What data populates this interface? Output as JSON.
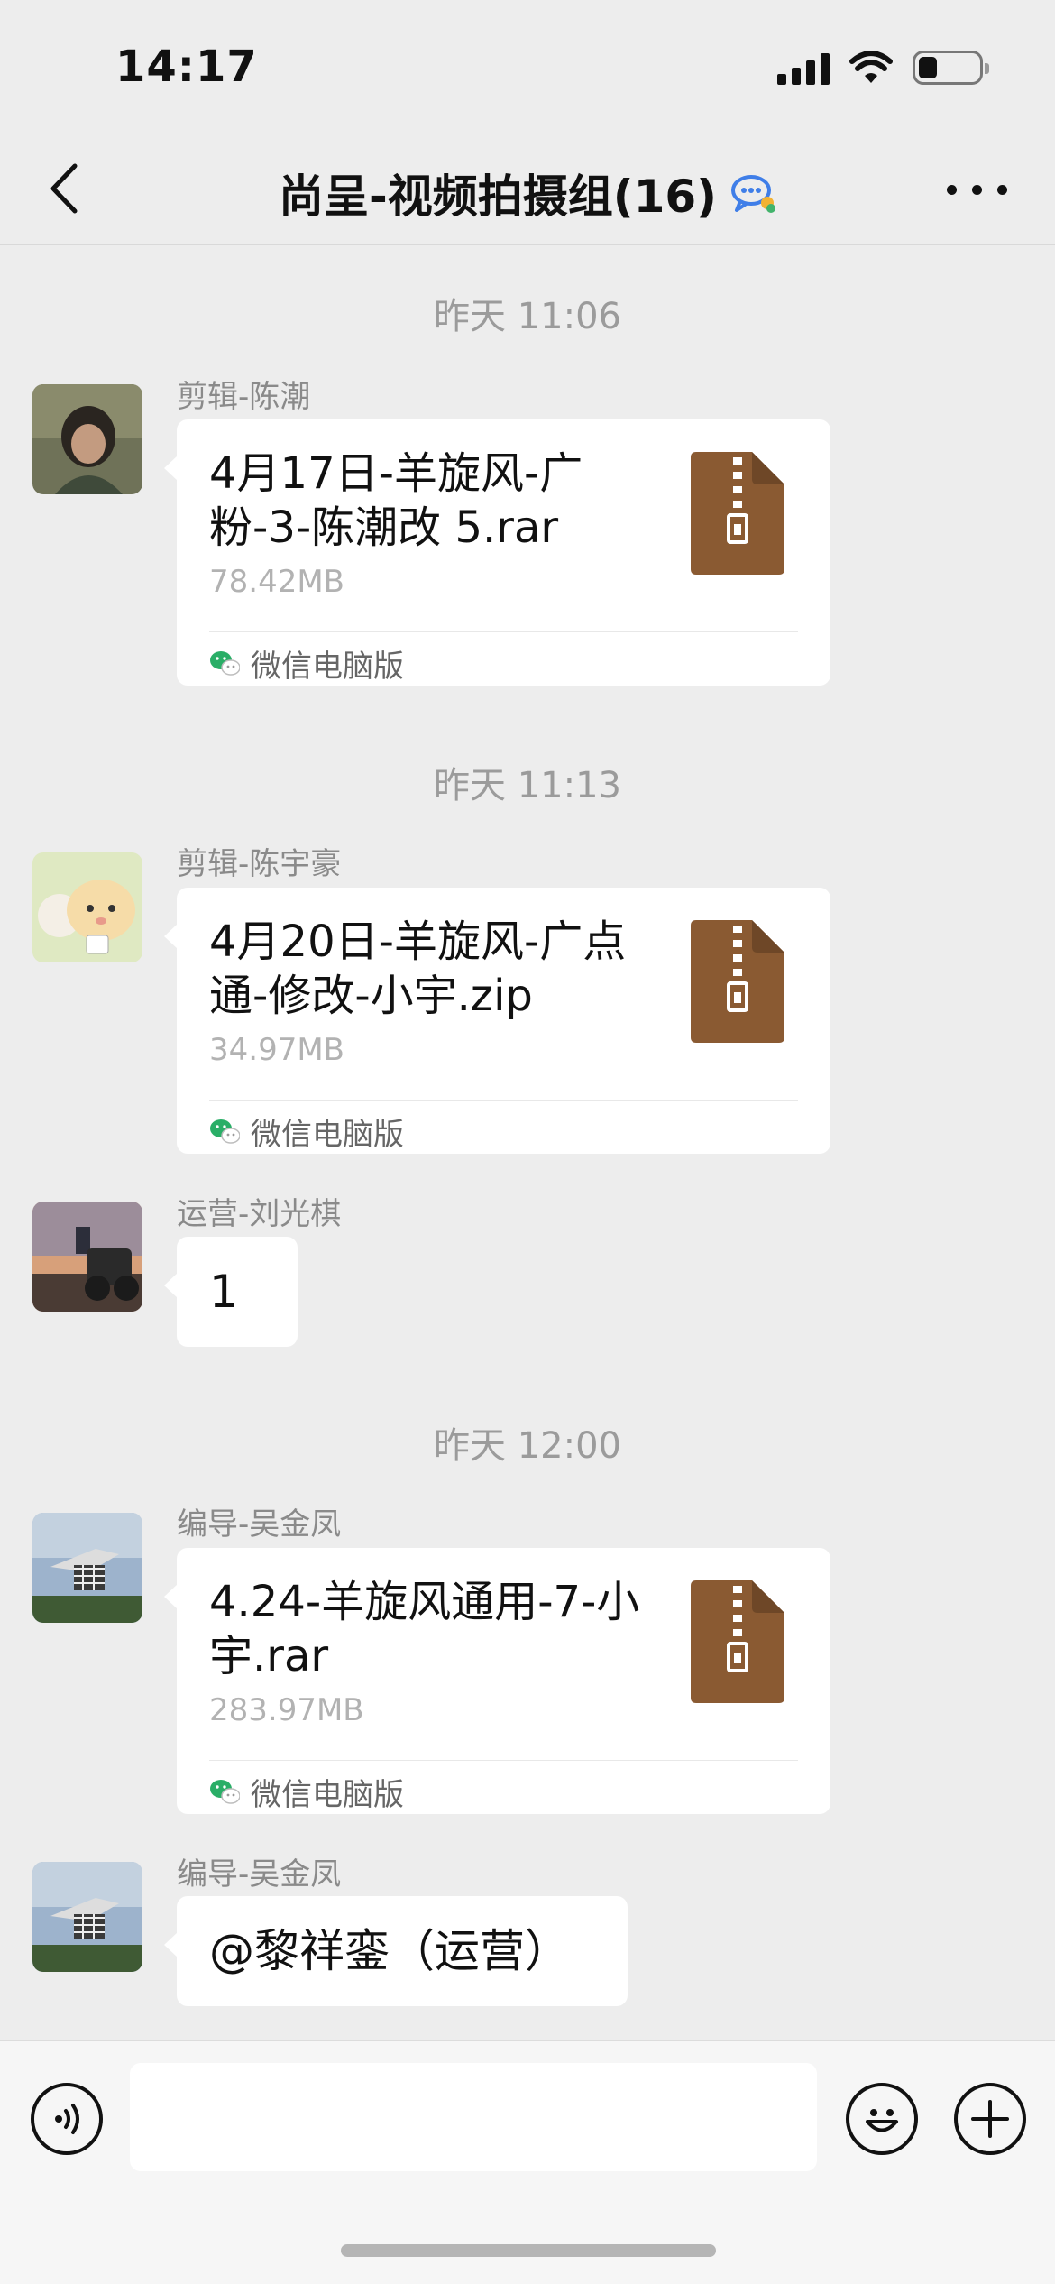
{
  "status_bar": {
    "time": "14:17"
  },
  "nav": {
    "title": "尚呈-视频拍摄组(16)"
  },
  "messages": [
    {
      "timestamp": "昨天 11:06",
      "sender": "剪辑-陈潮",
      "file_name": "4月17日-羊旋风-广粉-3-陈潮改 5.rar",
      "file_size": "78.42MB",
      "source": "微信电脑版"
    },
    {
      "timestamp": "昨天 11:13",
      "sender": "剪辑-陈宇豪",
      "file_name": "4月20日-羊旋风-广点通-修改-小宇.zip",
      "file_size": "34.97MB",
      "source": "微信电脑版"
    },
    {
      "sender": "运营-刘光棋",
      "text": "1"
    },
    {
      "timestamp": "昨天 12:00",
      "sender": "编导-吴金凤",
      "file_name": "4.24-羊旋风通用-7-小宇.rar",
      "file_size": "283.97MB",
      "source": "微信电脑版"
    },
    {
      "sender": "编导-吴金凤",
      "text": "@黎祥銮（运营）"
    }
  ],
  "input": {
    "value": ""
  },
  "icons": {
    "back": "chevron-left-icon",
    "group_badge": "chat-bubble-icon",
    "more": "more-icon",
    "voice": "voice-icon",
    "emoji": "emoji-icon",
    "add": "plus-icon",
    "file": "zip-file-icon",
    "source": "wechat-icon"
  },
  "colors": {
    "background": "#ededed",
    "bubble": "#ffffff",
    "zip_file": "#8a5a32",
    "wechat_green": "#2aae67"
  }
}
